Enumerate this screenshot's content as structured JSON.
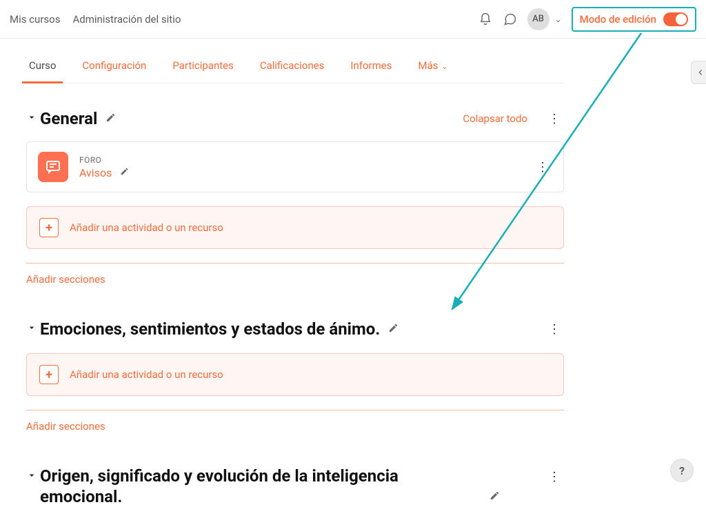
{
  "topbar": {
    "my_courses": "Mis cursos",
    "site_admin": "Administración del sitio",
    "user_initials": "AB",
    "edit_mode_label": "Modo de edición"
  },
  "tabs": {
    "course": "Curso",
    "settings": "Configuración",
    "participants": "Participantes",
    "grades": "Calificaciones",
    "reports": "Informes",
    "more": "Más"
  },
  "collapse_all": "Colapsar todo",
  "add_activity_label": "Añadir una actividad o un recurso",
  "add_sections_label": "Añadir secciones",
  "sections": [
    {
      "title": "General",
      "activities": [
        {
          "type": "FORO",
          "name": "Avisos"
        }
      ]
    },
    {
      "title": "Emociones, sentimientos y estados de ánimo."
    },
    {
      "title": "Origen, significado y evolución de la inteligencia emocional."
    }
  ],
  "help_label": "?"
}
